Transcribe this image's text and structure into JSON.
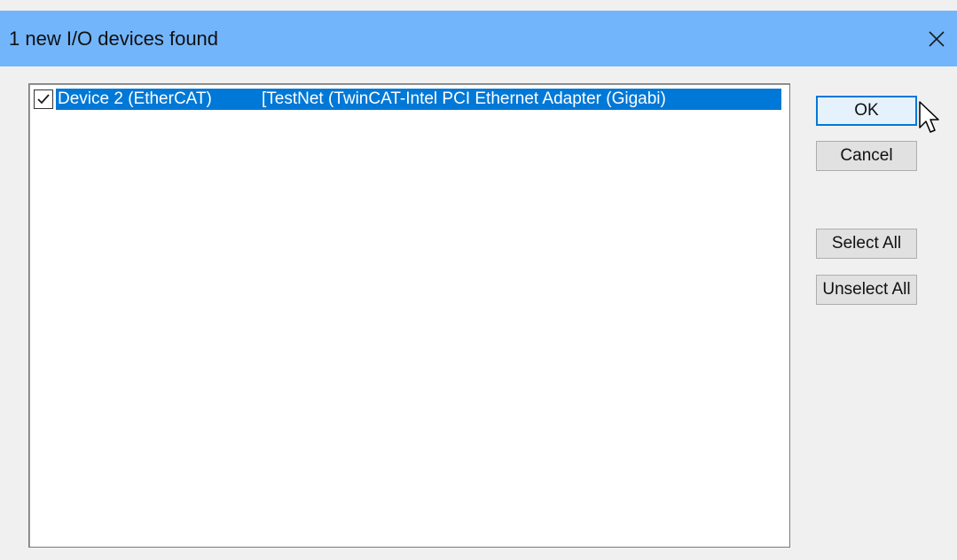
{
  "window": {
    "title": "1 new I/O devices found",
    "close_icon": "close-icon"
  },
  "device_list": {
    "items": [
      {
        "checked": true,
        "name": "Device 2 (EtherCAT)",
        "detail": "[TestNet (TwinCAT-Intel PCI Ethernet Adapter (Gigabi)"
      }
    ]
  },
  "buttons": {
    "ok": "OK",
    "cancel": "Cancel",
    "select_all": "Select All",
    "unselect_all": "Unselect All"
  },
  "colors": {
    "titlebar": "#72b5fb",
    "selection": "#0078d7",
    "dialog_bg": "#f0f0f0",
    "button_bg": "#e1e1e1"
  }
}
